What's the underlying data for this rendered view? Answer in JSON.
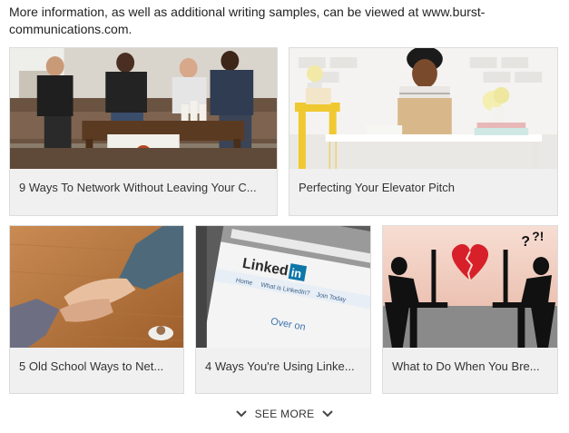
{
  "intro_text": "More information, as well as additional writing samples, can be viewed at www.burst-communications.com.",
  "cards": [
    {
      "title": "9 Ways To Network Without Leaving Your C..."
    },
    {
      "title": "Perfecting Your Elevator Pitch"
    },
    {
      "title": "5 Old School Ways to Net..."
    },
    {
      "title": "4 Ways You're Using Linke..."
    },
    {
      "title": "What to Do When You Bre..."
    }
  ],
  "linkedin_browser_text": {
    "logo": "Linked",
    "logo_in": "in",
    "nav_home": "Home",
    "nav_what": "What is LinkedIn?",
    "nav_join": "Join Today",
    "overlay": "Over on"
  },
  "see_more_label": "SEE MORE",
  "icons": {
    "see_more_left": "chevron-down-icon",
    "see_more_right": "chevron-down-icon"
  },
  "colors": {
    "card_bg": "#f0f0f0",
    "card_border": "#dcdcdc",
    "text": "#333333",
    "heart_red": "#d8202a",
    "linkedin_blue": "#0e76a8"
  }
}
